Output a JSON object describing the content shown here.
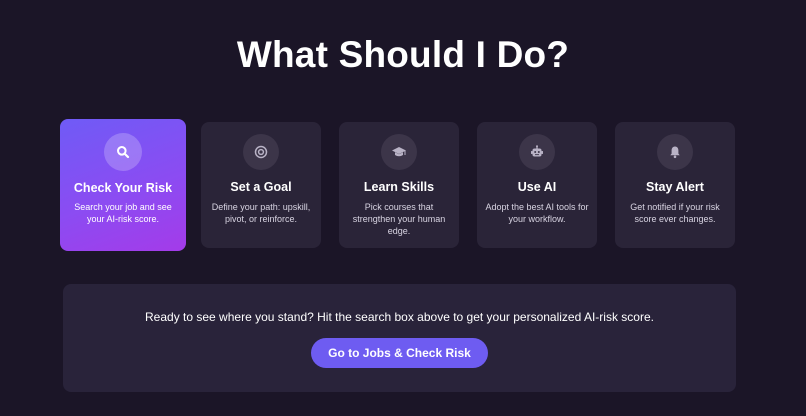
{
  "page": {
    "title": "What Should I Do?"
  },
  "cards": [
    {
      "title": "Check Your Risk",
      "description": "Search your job and see your AI-risk score.",
      "icon": "search-icon",
      "active": true
    },
    {
      "title": "Set a Goal",
      "description": "Define your path: upskill, pivot, or reinforce.",
      "icon": "target-icon",
      "active": false
    },
    {
      "title": "Learn Skills",
      "description": "Pick courses that strengthen your human edge.",
      "icon": "graduation-cap-icon",
      "active": false
    },
    {
      "title": "Use AI",
      "description": "Adopt the best AI tools for your workflow.",
      "icon": "robot-icon",
      "active": false
    },
    {
      "title": "Stay Alert",
      "description": "Get notified if your risk score ever changes.",
      "icon": "bell-icon",
      "active": false
    }
  ],
  "cta": {
    "text": "Ready to see where you stand? Hit the search box above to get your personalized AI-risk score.",
    "button_label": "Go to Jobs & Check Risk"
  },
  "colors": {
    "background": "#1b1527",
    "card": "#2a2438",
    "accent_start": "#6f5bf6",
    "accent_end": "#a43be9",
    "button": "#6e5cf1"
  }
}
